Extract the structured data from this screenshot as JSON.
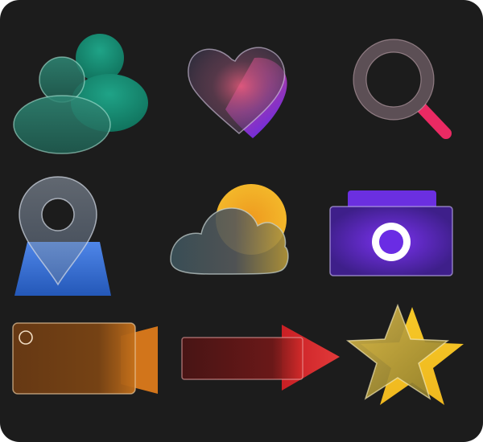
{
  "colors": {
    "background": "#1c1c1c",
    "frame": "#ffffff",
    "users_accent": "#1a8f78",
    "heart_gradient": [
      "#e24b6a",
      "#7b2bd6"
    ],
    "search_handle": "#ea2a63",
    "location_base": "#3a6fd6",
    "sun": "#f0b32a",
    "camera_purple": "#6b2fe0",
    "video_orange": "#d2751b",
    "arrow_red": "#d7262b",
    "star_yellow": "#f5c827"
  },
  "icons": [
    {
      "id": "users",
      "icon": "users-icon"
    },
    {
      "id": "heart",
      "icon": "heart-icon"
    },
    {
      "id": "search",
      "icon": "search-icon"
    },
    {
      "id": "location",
      "icon": "location-pin-icon"
    },
    {
      "id": "weather",
      "icon": "cloud-sun-icon"
    },
    {
      "id": "camera",
      "icon": "camera-icon"
    },
    {
      "id": "video",
      "icon": "video-camera-icon"
    },
    {
      "id": "arrow",
      "icon": "arrow-right-icon"
    },
    {
      "id": "star",
      "icon": "star-icon"
    }
  ]
}
